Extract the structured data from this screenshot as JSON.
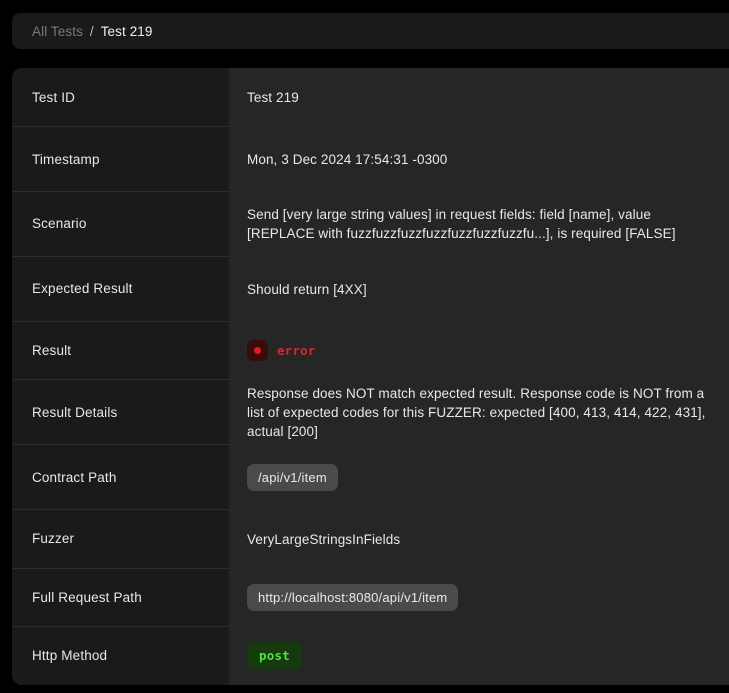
{
  "breadcrumb": {
    "root": "All Tests",
    "separator": "/",
    "current": "Test 219"
  },
  "detail": {
    "rows": [
      {
        "label": "Test ID",
        "value": "Test 219"
      },
      {
        "label": "Timestamp",
        "value": "Mon, 3 Dec 2024 17:54:31 -0300"
      },
      {
        "label": "Scenario",
        "value": "Send [very large string values] in request fields: field [name], value [REPLACE with fuzzfuzzfuzzfuzzfuzzfuzzfuzzfu...], is required [FALSE]"
      },
      {
        "label": "Expected Result",
        "value": "Should return [4XX]"
      },
      {
        "label": "Result",
        "value": "error"
      },
      {
        "label": "Result Details",
        "value": "Response does NOT match expected result. Response code is NOT from a list of expected codes for this FUZZER: expected [400, 413, 414, 422, 431], actual [200]"
      },
      {
        "label": "Contract Path",
        "value": "/api/v1/item"
      },
      {
        "label": "Fuzzer",
        "value": "VeryLargeStringsInFields"
      },
      {
        "label": "Full Request Path",
        "value": "http://localhost:8080/api/v1/item"
      },
      {
        "label": "Http Method",
        "value": "post"
      }
    ]
  },
  "colors": {
    "page_background": "#000000",
    "label_column": "#1a1a1a",
    "value_column": "#262626",
    "divider": "#2c2c2c",
    "text_primary": "#e8e8e8",
    "text_muted": "#7a7a7a",
    "error_red": "#e0242e",
    "error_badge_bg": "#3a0b0b",
    "method_green": "#4ce23f",
    "method_badge_bg": "#143a0d",
    "chip_bg": "#4a4a4a"
  },
  "icons": {
    "status": "error-dot-icon"
  }
}
